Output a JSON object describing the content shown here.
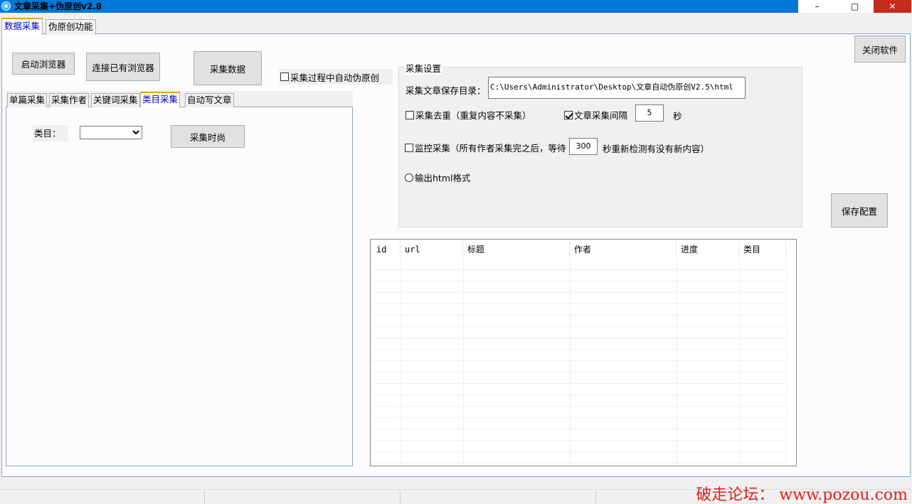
{
  "window": {
    "title": "文章采集+伪原创v2.8",
    "minimize_symbol": "–",
    "maximize_symbol": "□",
    "close_symbol": "✕"
  },
  "main_tabs": [
    {
      "label": "数据采集",
      "active": true
    },
    {
      "label": "伪原创功能",
      "active": false
    }
  ],
  "toolbar": {
    "launch_browser": "启动浏览器",
    "connect_browser": "连接已有浏览器",
    "collect_data": "采集数据",
    "auto_rewrite_label": "采集过程中自动伪原创",
    "auto_rewrite_checked": false,
    "close_software": "关闭软件",
    "save_config": "保存配置"
  },
  "sub_tabs": [
    {
      "label": "单篇采集",
      "active": false
    },
    {
      "label": "采集作者",
      "active": false
    },
    {
      "label": "关键词采集",
      "active": false
    },
    {
      "label": "类目采集",
      "active": true
    },
    {
      "label": "自动写文章",
      "active": false
    }
  ],
  "category_panel": {
    "category_label": "类目：",
    "category_value": "",
    "collect_fashion": "采集时尚"
  },
  "settings": {
    "group_title": "采集设置",
    "save_dir_label": "采集文章保存目录：",
    "save_dir_value": "C:\\Users\\Administrator\\Desktop\\文章自动伪原创V2.5\\html",
    "dedup_label": "采集去重（重复内容不采集）",
    "dedup_checked": false,
    "interval_label": "文章采集间隔",
    "interval_checked": true,
    "interval_value": "5",
    "interval_unit": "秒",
    "monitor_label": "监控采集（所有作者采集完之后，等待",
    "monitor_checked": false,
    "monitor_value": "300",
    "monitor_suffix": "秒重新检测有没有新内容）",
    "html_output_label": "输出html格式",
    "html_output_selected": false
  },
  "grid": {
    "columns": [
      "id",
      "url",
      "标题",
      "作者",
      "进度",
      "类目"
    ],
    "rows": []
  },
  "watermark": "破走论坛： www.pozou.com"
}
